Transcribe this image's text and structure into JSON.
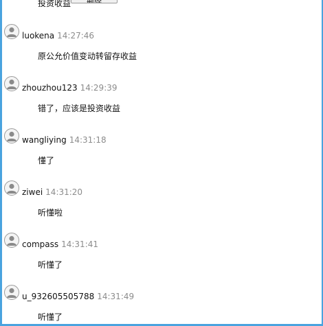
{
  "top": {
    "partial_message": "投资收益",
    "button_label": "删除"
  },
  "messages": [
    {
      "user": "luokena",
      "time": "14:27:46",
      "text": "原公允价值变动转留存收益"
    },
    {
      "user": "zhouzhou123",
      "time": "14:29:39",
      "text": "错了，应该是投资收益"
    },
    {
      "user": "wangliying",
      "time": "14:31:18",
      "text": "懂了"
    },
    {
      "user": "ziwei",
      "time": "14:31:20",
      "text": "听懂啦"
    },
    {
      "user": "compass",
      "time": "14:31:41",
      "text": "听懂了"
    },
    {
      "user": "u_932605505788",
      "time": "14:31:49",
      "text": "听懂了"
    }
  ],
  "colors": {
    "frame_border": "#4aa3df",
    "timestamp": "#8c8c8c",
    "text": "#111111"
  },
  "icons": {
    "avatar": "user-avatar-icon"
  }
}
